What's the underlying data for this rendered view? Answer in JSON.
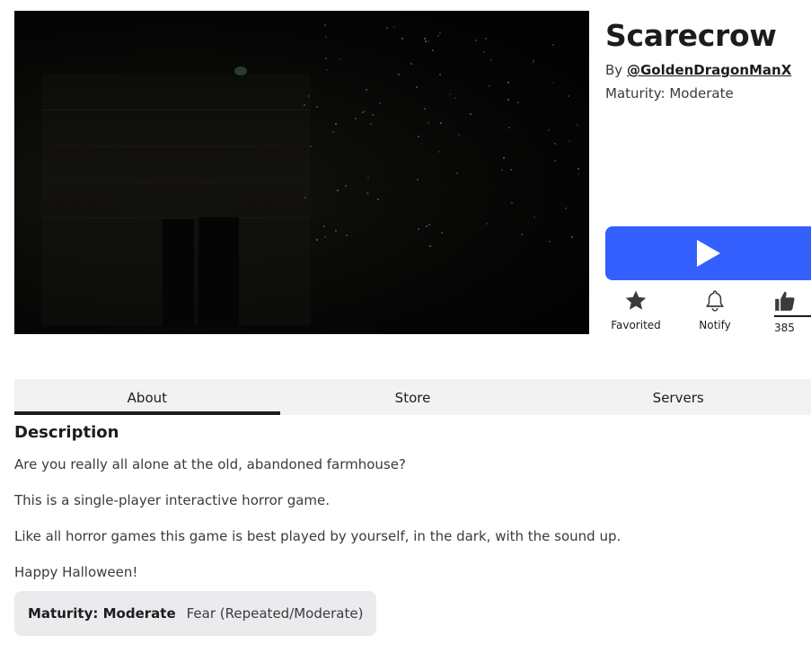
{
  "game": {
    "title": "Scarecrow",
    "by_prefix": "By",
    "creator": "@GoldenDragonManX",
    "maturity_label": "Maturity: Moderate"
  },
  "actions": {
    "play_icon": "play-icon",
    "favorite": {
      "label": "Favorited",
      "icon": "star-icon"
    },
    "notify": {
      "label": "Notify",
      "icon": "bell-icon"
    },
    "like": {
      "count": "385",
      "icon": "thumbs-up-icon"
    }
  },
  "tabs": [
    {
      "label": "About",
      "active": true
    },
    {
      "label": "Store",
      "active": false
    },
    {
      "label": "Servers",
      "active": false
    }
  ],
  "description": {
    "heading": "Description",
    "lines": [
      "Are you really all alone at the old, abandoned farmhouse?",
      "This is a single-player interactive horror game.",
      "Like all horror games this game is best played by yourself, in the dark, with the sound up.",
      "Happy Halloween!"
    ]
  },
  "maturity_chip": {
    "label": "Maturity: Moderate",
    "detail": "Fear (Repeated/Moderate)"
  },
  "colors": {
    "accent": "#335fff",
    "text": "#1b1c1d",
    "tab_bg": "#f2f2f3"
  }
}
